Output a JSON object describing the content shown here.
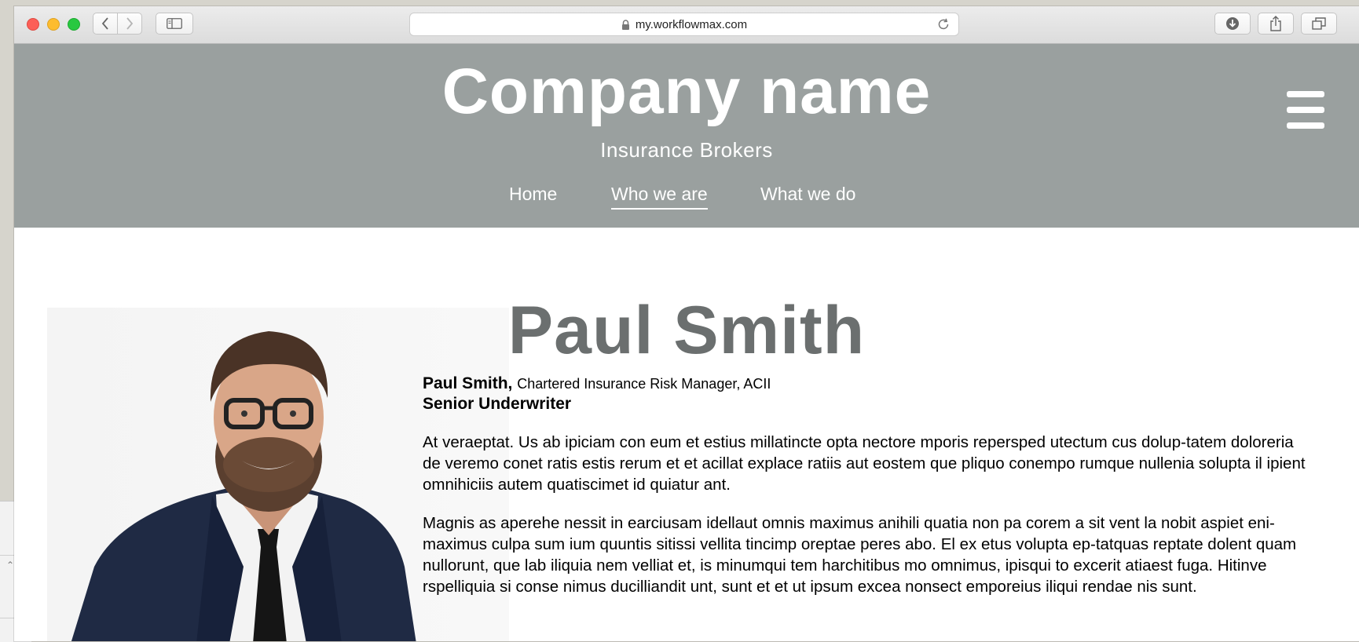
{
  "browser": {
    "url": "my.workflowmax.com"
  },
  "site": {
    "company_name": "Company name",
    "tagline": "Insurance Brokers",
    "nav": [
      {
        "label": "Home",
        "active": false
      },
      {
        "label": "Who we are",
        "active": true
      },
      {
        "label": "What we do",
        "active": false
      }
    ]
  },
  "profile": {
    "heading": "Paul Smith",
    "name_label": "Paul Smith,",
    "qualifications": "Chartered Insurance Risk Manager, ACII",
    "role": "Senior Underwriter",
    "paragraphs": [
      "At veraeptat. Us ab ipiciam con eum et estius millatincte opta nectore mporis repersped utectum cus dolup-tatem doloreria de veremo conet ratis estis rerum et et acillat explace ratiis aut eostem que pliquo conempo rumque nullenia solupta il ipient omnihiciis autem quatiscimet id quiatur ant.",
      "Magnis as aperehe nessit in earciusam idellaut omnis maximus anihili quatia non pa corem a sit vent la nobit aspiet eni-maximus culpa sum ium quuntis sitissi vellita tincimp oreptae peres abo. El ex etus volupta ep-tatquas reptate dolent quam nullorunt, que lab iliquia nem velliat et, is minumqui tem harchitibus mo omnimus, ipisqui to excerit atiaest fuga. Hitinve rspelliquia si conse nimus ducilliandit unt, sunt et et ut ipsum excea nonsect emporeius iliqui rendae nis sunt."
    ]
  },
  "colors": {
    "header_bg": "#9aa09f",
    "heading_text": "#6b6f6f"
  },
  "icons": {
    "lock": "lock-icon",
    "reload": "reload-icon",
    "menu": "hamburger-menu-icon"
  }
}
